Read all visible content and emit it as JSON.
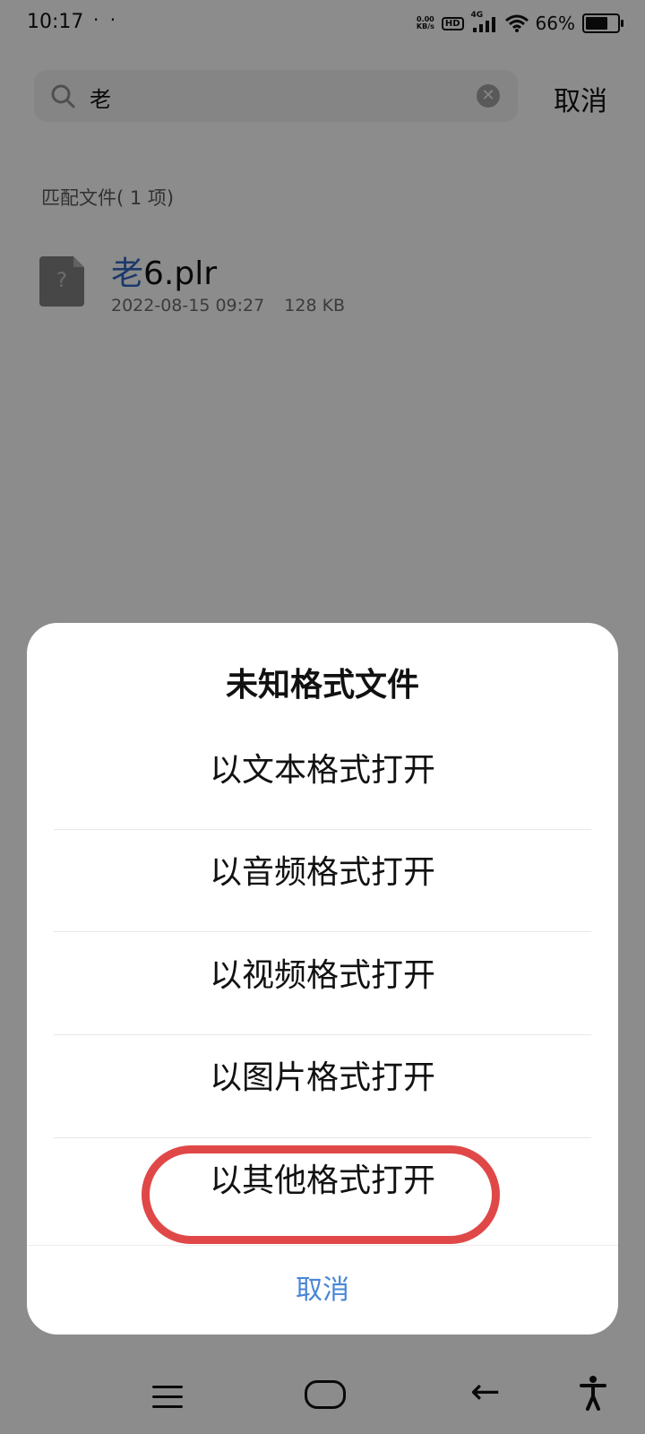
{
  "status_bar": {
    "time": "10:17",
    "dots": "· ·",
    "net_speed_value": "0.00",
    "net_speed_unit": "KB/s",
    "hd": "HD",
    "network": "4G",
    "battery_pct": "66%"
  },
  "search": {
    "query": "老",
    "cancel_label": "取消"
  },
  "results": {
    "label": "匹配文件( 1 项)",
    "files": [
      {
        "name_highlight": "老",
        "name_rest": "6.plr",
        "date": "2022-08-15 09:27",
        "size": "128 KB",
        "icon_glyph": "?"
      }
    ]
  },
  "dialog": {
    "title": "未知格式文件",
    "options": [
      "以文本格式打开",
      "以音频格式打开",
      "以视频格式打开",
      "以图片格式打开",
      "以其他格式打开"
    ],
    "cancel_label": "取消"
  },
  "colors": {
    "accent_blue": "#4a86d6",
    "highlight_red": "#e04848",
    "match_blue": "#2f63b8"
  }
}
